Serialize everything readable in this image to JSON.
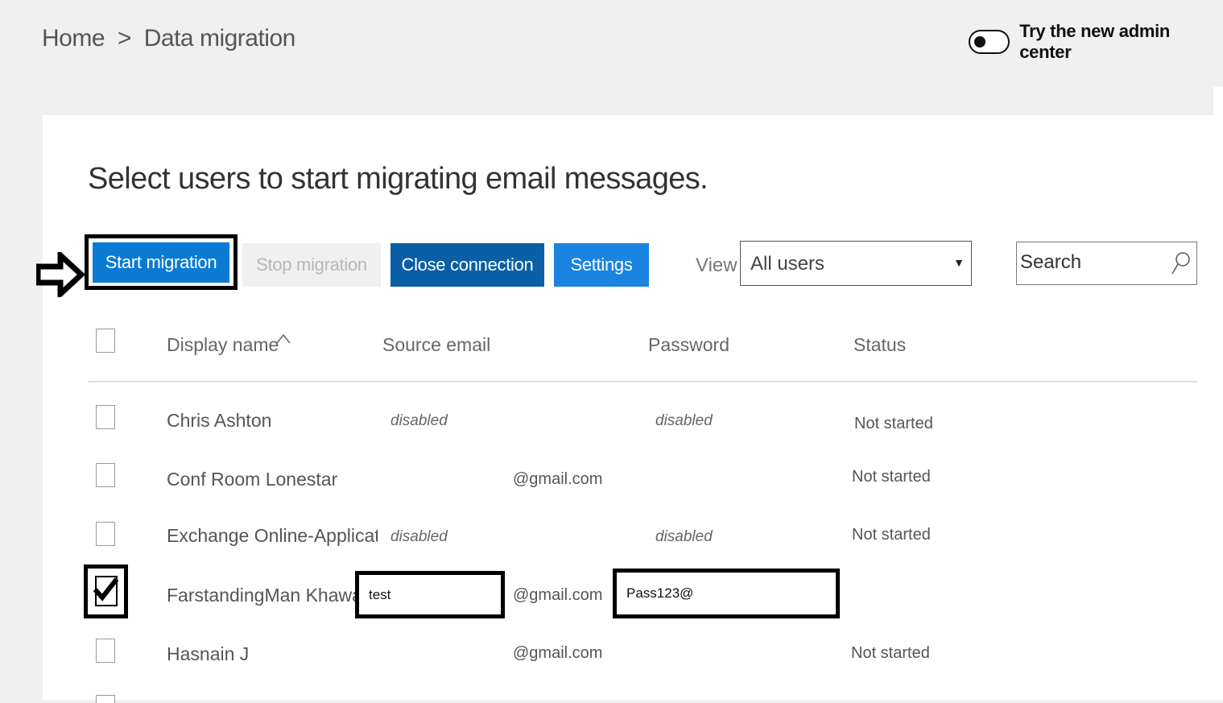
{
  "breadcrumb": {
    "home": "Home",
    "separator": ">",
    "current": "Data migration"
  },
  "toggle": {
    "label": "Try the new admin center",
    "state": "off"
  },
  "heading": "Select users to start migrating email messages.",
  "toolbar": {
    "start_label": "Start migration",
    "stop_label": "Stop migration",
    "close_label": "Close connection",
    "settings_label": "Settings",
    "view_label": "View",
    "view_value": "All users",
    "search_placeholder": "Search"
  },
  "table": {
    "columns": {
      "display_name": "Display name",
      "source_email": "Source email",
      "password": "Password",
      "status": "Status"
    },
    "rows": [
      {
        "name": "Chris Ashton",
        "source": "disabled",
        "password": "disabled",
        "status": "Not started"
      },
      {
        "name": "Conf Room Lonestar",
        "domain": "@gmail.com",
        "status": "Not started"
      },
      {
        "name": "Exchange Online-ApplicationAccc",
        "source": "disabled",
        "password": "disabled",
        "status": "Not started"
      },
      {
        "name": "FarstandingMan Khawaja",
        "source_value": "test",
        "domain": "@gmail.com",
        "password_value": "Pass123@",
        "checked": true
      },
      {
        "name": "Hasnain J",
        "domain": "@gmail.com",
        "status": "Not started"
      }
    ]
  },
  "colors": {
    "primary": "#0a7ad4",
    "dark_primary": "#0a5fa6",
    "settings": "#1a84e0",
    "disabled": "#b8b8b8"
  }
}
